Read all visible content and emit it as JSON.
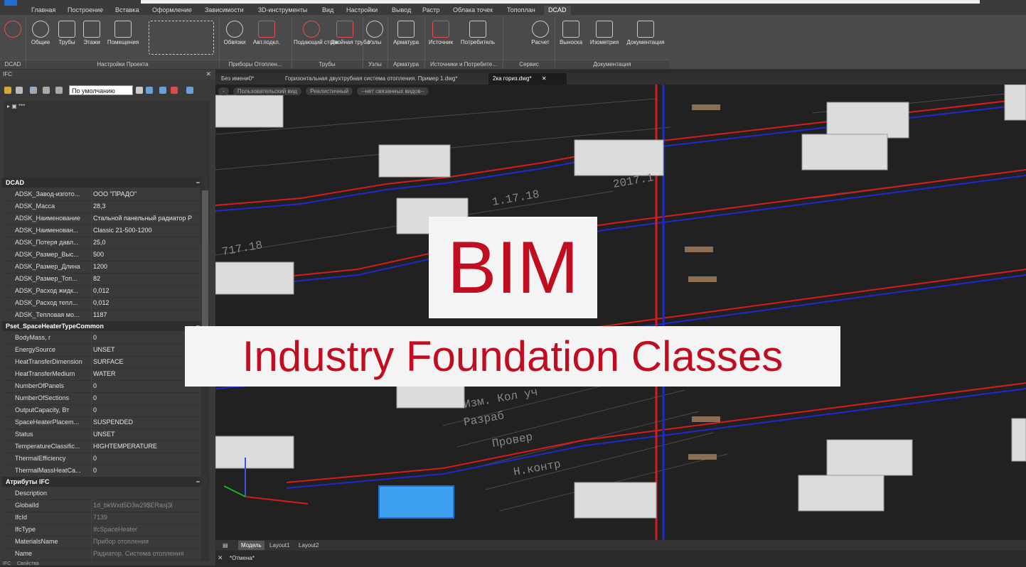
{
  "menu_tabs": [
    "Главная",
    "Построение",
    "Вставка",
    "Оформление",
    "Зависимости",
    "3D-инструменты",
    "Вид",
    "Настройки",
    "Вывод",
    "Растр",
    "Облака точек",
    "Топоплан",
    "DCAD"
  ],
  "ribbon": {
    "buttons": [
      "Общие",
      "Трубы",
      "Этажи",
      "Помещения",
      "Обвязки",
      "Авт.подкл.",
      "Подающий стояк",
      "Двойная труба",
      "Узлы",
      "Арматура",
      "Источник",
      "Потребитель",
      "Расчет",
      "Выноска",
      "Изометрия",
      "Документация"
    ],
    "groups": [
      "DCAD",
      "Настройки Проекта",
      "Приборы Отоплен...",
      "Трубы",
      "Узлы",
      "Арматура",
      "Источники и Потребите...",
      "Сервис",
      "Документация"
    ]
  },
  "panel": {
    "title": "IFC",
    "view_select": "По умолчанию",
    "tree_item": "***",
    "sections": [
      {
        "title": "DCAD",
        "rows": [
          {
            "k": "ADSK_Завод-изгото...",
            "v": "ООО \"ПРАДО\""
          },
          {
            "k": "ADSK_Масса",
            "v": "28,3"
          },
          {
            "k": "ADSK_Наименование",
            "v": "Стальной панельный радиатор P"
          },
          {
            "k": "ADSK_Наименован...",
            "v": "Classic 21-500-1200"
          },
          {
            "k": "ADSK_Потеря давл...",
            "v": "25,0"
          },
          {
            "k": "ADSK_Размер_Выс...",
            "v": "500"
          },
          {
            "k": "ADSK_Размер_Длина",
            "v": "1200"
          },
          {
            "k": "ADSK_Размер_Топ...",
            "v": "82"
          },
          {
            "k": "ADSK_Расход жидк...",
            "v": "0,012"
          },
          {
            "k": "ADSK_Расход тепл...",
            "v": "0,012"
          },
          {
            "k": "ADSK_Тепловая мо...",
            "v": "1187"
          }
        ]
      },
      {
        "title": "Pset_SpaceHeaterTypeCommon",
        "rows": [
          {
            "k": "BodyMass, г",
            "v": "0"
          },
          {
            "k": "EnergySource",
            "v": "UNSET"
          },
          {
            "k": "HeatTransferDimension",
            "v": "SURFACE"
          },
          {
            "k": "HeatTransferMedium",
            "v": "WATER"
          },
          {
            "k": "NumberOfPanels",
            "v": "0"
          },
          {
            "k": "NumberOfSections",
            "v": "0"
          },
          {
            "k": "OutputCapacity, Вт",
            "v": "0"
          },
          {
            "k": "SpaceHeaterPlacem...",
            "v": "SUSPENDED"
          },
          {
            "k": "Status",
            "v": "UNSET"
          },
          {
            "k": "TemperatureClassific...",
            "v": "HIGHTEMPERATURE"
          },
          {
            "k": "ThermalEfficiency",
            "v": "0"
          },
          {
            "k": "ThermalMassHeatCa...",
            "v": "0"
          }
        ]
      },
      {
        "title": "Атрибуты IFC",
        "rows": [
          {
            "k": "Description",
            "v": ""
          },
          {
            "k": "GlobalId",
            "v": "1d_bkWxd5D3w29$ERasj3l"
          },
          {
            "k": "IfcId",
            "v": "7139"
          },
          {
            "k": "IfcType",
            "v": "IfcSpaceHeater"
          },
          {
            "k": "MaterialsName",
            "v": "Прибор отопления"
          },
          {
            "k": "Name",
            "v": "Радиатор. Система отопления"
          }
        ]
      }
    ],
    "bottom_tabs": [
      "IFC",
      "Свойства"
    ]
  },
  "doc_tabs": [
    "Без имени0*",
    "Горизонтальная двухтрубная система отопления. Пример 1.dwg*",
    "2ка гориз.dwg*"
  ],
  "viewbar": [
    "-",
    "Пользовательский вид",
    "Реалистичный",
    "--нет связанных видов--"
  ],
  "drawing_labels": [
    "Изм. Кол уч",
    "Разраб",
    "Провер",
    "Н.контр",
    "1.17.18",
    "717.18",
    "2017.1"
  ],
  "overlay": {
    "title": "BIM",
    "subtitle": "Industry Foundation Classes"
  },
  "layout_tabs": [
    "Модель",
    "Layout1",
    "Layout2"
  ],
  "command": "*Отмена*",
  "colors": {
    "accent": "#c00d20",
    "supply_pipe": "#d81b1b",
    "return_pipe": "#1e2ad0"
  }
}
